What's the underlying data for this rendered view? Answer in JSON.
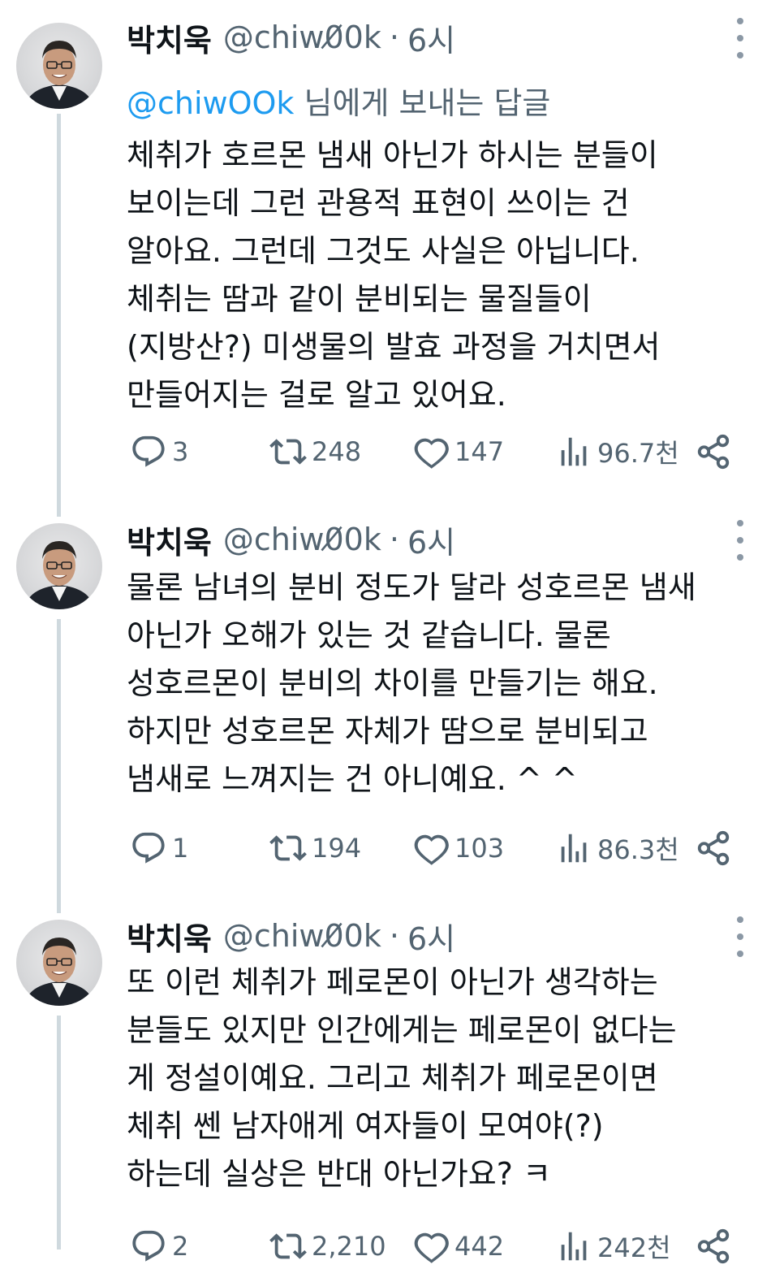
{
  "tweets": [
    {
      "name": "박치욱",
      "handle": "@chiw0_0k",
      "handle_text": "@chiw0̸0k",
      "dot": "·",
      "time": "6시",
      "reply_mention": "@chiwOOk",
      "reply_suffix": " 님에게 보내는 답글",
      "lines": [
        "체취가 호르몬 냄새 아닌가 하시는 분들이",
        "보이는데 그런 관용적 표현이 쓰이는 건",
        "알아요. 그런데 그것도 사실은 아닙니다.",
        "체취는 땀과 같이 분비되는 물질들이",
        "(지방산?) 미생물의 발효 과정을 거치면서",
        "만들어지는 걸로 알고 있어요."
      ],
      "replies": "3",
      "retweets": "248",
      "likes": "147",
      "views": "96.7천"
    },
    {
      "name": "박치욱",
      "handle_text": "@chiw0̸0k",
      "dot": "·",
      "time": "6시",
      "lines": [
        "물론 남녀의 분비 정도가 달라 성호르몬 냄새",
        "아닌가 오해가 있는 것 같습니다. 물론",
        "성호르몬이 분비의 차이를 만들기는 해요.",
        "하지만 성호르몬 자체가 땀으로 분비되고",
        "냄새로 느껴지는 건 아니예요. ^ ^"
      ],
      "replies": "1",
      "retweets": "194",
      "likes": "103",
      "views": "86.3천"
    },
    {
      "name": "박치욱",
      "handle_text": "@chiw0̸0k",
      "dot": "·",
      "time": "6시",
      "lines": [
        "또 이런 체취가 페로몬이 아닌가 생각하는",
        "분들도 있지만 인간에게는 페로몬이 없다는",
        "게 정설이예요. 그리고 체취가 페로몬이면",
        "체취 쎈 남자애게 여자들이 모여야(?)",
        "하는데 실상은 반대 아닌가요? ㅋ"
      ],
      "replies": "2",
      "retweets": "2,210",
      "likes": "442",
      "views": "242천"
    }
  ],
  "icons": {
    "reply": "reply-icon",
    "retweet": "retweet-icon",
    "like": "heart-icon",
    "views": "views-icon",
    "share": "share-icon",
    "more": "more-icon"
  },
  "colors": {
    "text": "#0f1419",
    "secondary": "#536471",
    "mention": "#1d9bf0",
    "thread_line": "#cfd9de"
  }
}
